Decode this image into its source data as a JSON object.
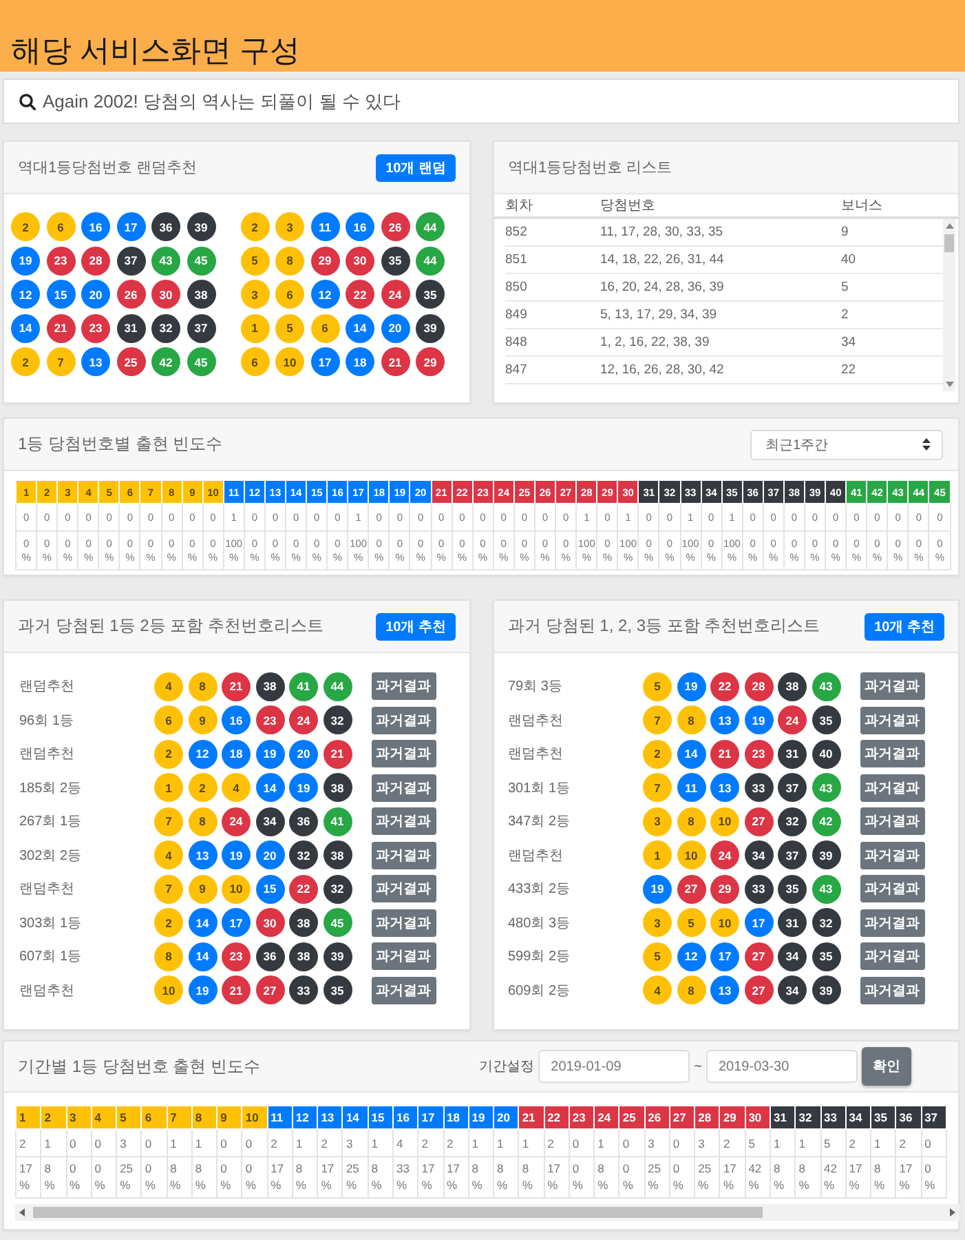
{
  "header": {
    "title": "해당 서비스화면 구성"
  },
  "search": {
    "value": "Again 2002! 당첨의 역사는 되풀이 될 수 있다"
  },
  "random_pick": {
    "title": "역대1등당첨번호 랜덤추천",
    "button": "10개 랜덤",
    "groups": [
      [
        [
          {
            "n": "2",
            "color": "#ffc107"
          },
          {
            "n": "6",
            "color": "#ffc107"
          },
          {
            "n": "16",
            "color": "#007bff"
          },
          {
            "n": "17",
            "color": "#007bff"
          },
          {
            "n": "36",
            "color": "#343a40"
          },
          {
            "n": "39",
            "color": "#343a40"
          }
        ],
        [
          {
            "n": "19",
            "color": "#007bff"
          },
          {
            "n": "23",
            "color": "#dc3545"
          },
          {
            "n": "28",
            "color": "#dc3545"
          },
          {
            "n": "37",
            "color": "#343a40"
          },
          {
            "n": "43",
            "color": "#28a745"
          },
          {
            "n": "45",
            "color": "#28a745"
          }
        ],
        [
          {
            "n": "12",
            "color": "#007bff"
          },
          {
            "n": "15",
            "color": "#007bff"
          },
          {
            "n": "20",
            "color": "#007bff"
          },
          {
            "n": "26",
            "color": "#dc3545"
          },
          {
            "n": "30",
            "color": "#dc3545"
          },
          {
            "n": "38",
            "color": "#343a40"
          }
        ],
        [
          {
            "n": "14",
            "color": "#007bff"
          },
          {
            "n": "21",
            "color": "#dc3545"
          },
          {
            "n": "23",
            "color": "#dc3545"
          },
          {
            "n": "31",
            "color": "#343a40"
          },
          {
            "n": "32",
            "color": "#343a40"
          },
          {
            "n": "37",
            "color": "#343a40"
          }
        ],
        [
          {
            "n": "2",
            "color": "#ffc107"
          },
          {
            "n": "7",
            "color": "#ffc107"
          },
          {
            "n": "13",
            "color": "#007bff"
          },
          {
            "n": "25",
            "color": "#dc3545"
          },
          {
            "n": "42",
            "color": "#28a745"
          },
          {
            "n": "45",
            "color": "#28a745"
          }
        ]
      ],
      [
        [
          {
            "n": "2",
            "color": "#ffc107"
          },
          {
            "n": "3",
            "color": "#ffc107"
          },
          {
            "n": "11",
            "color": "#007bff"
          },
          {
            "n": "16",
            "color": "#007bff"
          },
          {
            "n": "26",
            "color": "#dc3545"
          },
          {
            "n": "44",
            "color": "#28a745"
          }
        ],
        [
          {
            "n": "5",
            "color": "#ffc107"
          },
          {
            "n": "8",
            "color": "#ffc107"
          },
          {
            "n": "29",
            "color": "#dc3545"
          },
          {
            "n": "30",
            "color": "#dc3545"
          },
          {
            "n": "35",
            "color": "#343a40"
          },
          {
            "n": "44",
            "color": "#28a745"
          }
        ],
        [
          {
            "n": "3",
            "color": "#ffc107"
          },
          {
            "n": "6",
            "color": "#ffc107"
          },
          {
            "n": "12",
            "color": "#007bff"
          },
          {
            "n": "22",
            "color": "#dc3545"
          },
          {
            "n": "24",
            "color": "#dc3545"
          },
          {
            "n": "35",
            "color": "#343a40"
          }
        ],
        [
          {
            "n": "1",
            "color": "#ffc107"
          },
          {
            "n": "5",
            "color": "#ffc107"
          },
          {
            "n": "6",
            "color": "#ffc107"
          },
          {
            "n": "14",
            "color": "#007bff"
          },
          {
            "n": "20",
            "color": "#007bff"
          },
          {
            "n": "39",
            "color": "#343a40"
          }
        ],
        [
          {
            "n": "6",
            "color": "#ffc107"
          },
          {
            "n": "10",
            "color": "#ffc107"
          },
          {
            "n": "17",
            "color": "#007bff"
          },
          {
            "n": "18",
            "color": "#007bff"
          },
          {
            "n": "21",
            "color": "#dc3545"
          },
          {
            "n": "29",
            "color": "#dc3545"
          }
        ]
      ]
    ]
  },
  "winning_list": {
    "title": "역대1등당첨번호 리스트",
    "columns": [
      "회차",
      "당첨번호",
      "보너스"
    ],
    "rows": [
      {
        "round": "852",
        "numbers": "11, 17, 28, 30, 33, 35",
        "bonus": "9"
      },
      {
        "round": "851",
        "numbers": "14, 18, 22, 26, 31, 44",
        "bonus": "40"
      },
      {
        "round": "850",
        "numbers": "16, 20, 24, 28, 36, 39",
        "bonus": "5"
      },
      {
        "round": "849",
        "numbers": "5, 13, 17, 29, 34, 39",
        "bonus": "2"
      },
      {
        "round": "848",
        "numbers": "1, 2, 16, 22, 38, 39",
        "bonus": "34"
      },
      {
        "round": "847",
        "numbers": "12, 16, 26, 28, 30, 42",
        "bonus": "22"
      }
    ]
  },
  "weekly_frequency": {
    "title": "1등 당첨번호별 출현 빈도수",
    "select": {
      "value": "최근1주간"
    },
    "columns": [
      {
        "n": "1",
        "color": "#ffc107",
        "count": "0",
        "pct": "0 %"
      },
      {
        "n": "2",
        "color": "#ffc107",
        "count": "0",
        "pct": "0 %"
      },
      {
        "n": "3",
        "color": "#ffc107",
        "count": "0",
        "pct": "0 %"
      },
      {
        "n": "4",
        "color": "#ffc107",
        "count": "0",
        "pct": "0 %"
      },
      {
        "n": "5",
        "color": "#ffc107",
        "count": "0",
        "pct": "0 %"
      },
      {
        "n": "6",
        "color": "#ffc107",
        "count": "0",
        "pct": "0 %"
      },
      {
        "n": "7",
        "color": "#ffc107",
        "count": "0",
        "pct": "0 %"
      },
      {
        "n": "8",
        "color": "#ffc107",
        "count": "0",
        "pct": "0 %"
      },
      {
        "n": "9",
        "color": "#ffc107",
        "count": "0",
        "pct": "0 %"
      },
      {
        "n": "10",
        "color": "#ffc107",
        "count": "0",
        "pct": "0 %"
      },
      {
        "n": "11",
        "color": "#007bff",
        "count": "1",
        "pct": "100 %"
      },
      {
        "n": "12",
        "color": "#007bff",
        "count": "0",
        "pct": "0 %"
      },
      {
        "n": "13",
        "color": "#007bff",
        "count": "0",
        "pct": "0 %"
      },
      {
        "n": "14",
        "color": "#007bff",
        "count": "0",
        "pct": "0 %"
      },
      {
        "n": "15",
        "color": "#007bff",
        "count": "0",
        "pct": "0 %"
      },
      {
        "n": "16",
        "color": "#007bff",
        "count": "0",
        "pct": "0 %"
      },
      {
        "n": "17",
        "color": "#007bff",
        "count": "1",
        "pct": "100 %"
      },
      {
        "n": "18",
        "color": "#007bff",
        "count": "0",
        "pct": "0 %"
      },
      {
        "n": "19",
        "color": "#007bff",
        "count": "0",
        "pct": "0 %"
      },
      {
        "n": "20",
        "color": "#007bff",
        "count": "0",
        "pct": "0 %"
      },
      {
        "n": "21",
        "color": "#dc3545",
        "count": "0",
        "pct": "0 %"
      },
      {
        "n": "22",
        "color": "#dc3545",
        "count": "0",
        "pct": "0 %"
      },
      {
        "n": "23",
        "color": "#dc3545",
        "count": "0",
        "pct": "0 %"
      },
      {
        "n": "24",
        "color": "#dc3545",
        "count": "0",
        "pct": "0 %"
      },
      {
        "n": "25",
        "color": "#dc3545",
        "count": "0",
        "pct": "0 %"
      },
      {
        "n": "26",
        "color": "#dc3545",
        "count": "0",
        "pct": "0 %"
      },
      {
        "n": "27",
        "color": "#dc3545",
        "count": "0",
        "pct": "0 %"
      },
      {
        "n": "28",
        "color": "#dc3545",
        "count": "1",
        "pct": "100 %"
      },
      {
        "n": "29",
        "color": "#dc3545",
        "count": "0",
        "pct": "0 %"
      },
      {
        "n": "30",
        "color": "#dc3545",
        "count": "1",
        "pct": "100 %"
      },
      {
        "n": "31",
        "color": "#343a40",
        "count": "0",
        "pct": "0 %"
      },
      {
        "n": "32",
        "color": "#343a40",
        "count": "0",
        "pct": "0 %"
      },
      {
        "n": "33",
        "color": "#343a40",
        "count": "1",
        "pct": "100 %"
      },
      {
        "n": "34",
        "color": "#343a40",
        "count": "0",
        "pct": "0 %"
      },
      {
        "n": "35",
        "color": "#343a40",
        "count": "1",
        "pct": "100 %"
      },
      {
        "n": "36",
        "color": "#343a40",
        "count": "0",
        "pct": "0 %"
      },
      {
        "n": "37",
        "color": "#343a40",
        "count": "0",
        "pct": "0 %"
      },
      {
        "n": "38",
        "color": "#343a40",
        "count": "0",
        "pct": "0 %"
      },
      {
        "n": "39",
        "color": "#343a40",
        "count": "0",
        "pct": "0 %"
      },
      {
        "n": "40",
        "color": "#343a40",
        "count": "0",
        "pct": "0 %"
      },
      {
        "n": "41",
        "color": "#28a745",
        "count": "0",
        "pct": "0 %"
      },
      {
        "n": "42",
        "color": "#28a745",
        "count": "0",
        "pct": "0 %"
      },
      {
        "n": "43",
        "color": "#28a745",
        "count": "0",
        "pct": "0 %"
      },
      {
        "n": "44",
        "color": "#28a745",
        "count": "0",
        "pct": "0 %"
      },
      {
        "n": "45",
        "color": "#28a745",
        "count": "0",
        "pct": "0 %"
      }
    ]
  },
  "past_top2_list": {
    "title": "과거 당첨된 1등 2등 포함 추천번호리스트",
    "button": "10개 추천",
    "rows": [
      {
        "label": "랜덤추천",
        "button": "과거결과",
        "balls": [
          {
            "n": "4",
            "color": "#ffc107"
          },
          {
            "n": "8",
            "color": "#ffc107"
          },
          {
            "n": "21",
            "color": "#dc3545"
          },
          {
            "n": "38",
            "color": "#343a40"
          },
          {
            "n": "41",
            "color": "#28a745"
          },
          {
            "n": "44",
            "color": "#28a745"
          }
        ]
      },
      {
        "label": "96회 1등",
        "button": "과거결과",
        "balls": [
          {
            "n": "6",
            "color": "#ffc107"
          },
          {
            "n": "9",
            "color": "#ffc107"
          },
          {
            "n": "16",
            "color": "#007bff"
          },
          {
            "n": "23",
            "color": "#dc3545"
          },
          {
            "n": "24",
            "color": "#dc3545"
          },
          {
            "n": "32",
            "color": "#343a40"
          }
        ]
      },
      {
        "label": "랜덤추천",
        "button": "과거결과",
        "balls": [
          {
            "n": "2",
            "color": "#ffc107"
          },
          {
            "n": "12",
            "color": "#007bff"
          },
          {
            "n": "18",
            "color": "#007bff"
          },
          {
            "n": "19",
            "color": "#007bff"
          },
          {
            "n": "20",
            "color": "#007bff"
          },
          {
            "n": "21",
            "color": "#dc3545"
          }
        ]
      },
      {
        "label": "185회 2등",
        "button": "과거결과",
        "balls": [
          {
            "n": "1",
            "color": "#ffc107"
          },
          {
            "n": "2",
            "color": "#ffc107"
          },
          {
            "n": "4",
            "color": "#ffc107"
          },
          {
            "n": "14",
            "color": "#007bff"
          },
          {
            "n": "19",
            "color": "#007bff"
          },
          {
            "n": "38",
            "color": "#343a40"
          }
        ]
      },
      {
        "label": "267회 1등",
        "button": "과거결과",
        "balls": [
          {
            "n": "7",
            "color": "#ffc107"
          },
          {
            "n": "8",
            "color": "#ffc107"
          },
          {
            "n": "24",
            "color": "#dc3545"
          },
          {
            "n": "34",
            "color": "#343a40"
          },
          {
            "n": "36",
            "color": "#343a40"
          },
          {
            "n": "41",
            "color": "#28a745"
          }
        ]
      },
      {
        "label": "302회 2등",
        "button": "과거결과",
        "balls": [
          {
            "n": "4",
            "color": "#ffc107"
          },
          {
            "n": "13",
            "color": "#007bff"
          },
          {
            "n": "19",
            "color": "#007bff"
          },
          {
            "n": "20",
            "color": "#007bff"
          },
          {
            "n": "32",
            "color": "#343a40"
          },
          {
            "n": "38",
            "color": "#343a40"
          }
        ]
      },
      {
        "label": "랜덤추천",
        "button": "과거결과",
        "balls": [
          {
            "n": "7",
            "color": "#ffc107"
          },
          {
            "n": "9",
            "color": "#ffc107"
          },
          {
            "n": "10",
            "color": "#ffc107"
          },
          {
            "n": "15",
            "color": "#007bff"
          },
          {
            "n": "22",
            "color": "#dc3545"
          },
          {
            "n": "32",
            "color": "#343a40"
          }
        ]
      },
      {
        "label": "303회 1등",
        "button": "과거결과",
        "balls": [
          {
            "n": "2",
            "color": "#ffc107"
          },
          {
            "n": "14",
            "color": "#007bff"
          },
          {
            "n": "17",
            "color": "#007bff"
          },
          {
            "n": "30",
            "color": "#dc3545"
          },
          {
            "n": "38",
            "color": "#343a40"
          },
          {
            "n": "45",
            "color": "#28a745"
          }
        ]
      },
      {
        "label": "607회 1등",
        "button": "과거결과",
        "balls": [
          {
            "n": "8",
            "color": "#ffc107"
          },
          {
            "n": "14",
            "color": "#007bff"
          },
          {
            "n": "23",
            "color": "#dc3545"
          },
          {
            "n": "36",
            "color": "#343a40"
          },
          {
            "n": "38",
            "color": "#343a40"
          },
          {
            "n": "39",
            "color": "#343a40"
          }
        ]
      },
      {
        "label": "랜덤추천",
        "button": "과거결과",
        "balls": [
          {
            "n": "10",
            "color": "#ffc107"
          },
          {
            "n": "19",
            "color": "#007bff"
          },
          {
            "n": "21",
            "color": "#dc3545"
          },
          {
            "n": "27",
            "color": "#dc3545"
          },
          {
            "n": "33",
            "color": "#343a40"
          },
          {
            "n": "35",
            "color": "#343a40"
          }
        ]
      }
    ]
  },
  "past_top3_list": {
    "title": "과거 당첨된 1, 2, 3등 포함 추천번호리스트",
    "button": "10개 추천",
    "rows": [
      {
        "label": "79회 3등",
        "button": "과거결과",
        "balls": [
          {
            "n": "5",
            "color": "#ffc107"
          },
          {
            "n": "19",
            "color": "#007bff"
          },
          {
            "n": "22",
            "color": "#dc3545"
          },
          {
            "n": "28",
            "color": "#dc3545"
          },
          {
            "n": "38",
            "color": "#343a40"
          },
          {
            "n": "43",
            "color": "#28a745"
          }
        ]
      },
      {
        "label": "랜덤추천",
        "button": "과거결과",
        "balls": [
          {
            "n": "7",
            "color": "#ffc107"
          },
          {
            "n": "8",
            "color": "#ffc107"
          },
          {
            "n": "13",
            "color": "#007bff"
          },
          {
            "n": "19",
            "color": "#007bff"
          },
          {
            "n": "24",
            "color": "#dc3545"
          },
          {
            "n": "35",
            "color": "#343a40"
          }
        ]
      },
      {
        "label": "랜덤추천",
        "button": "과거결과",
        "balls": [
          {
            "n": "2",
            "color": "#ffc107"
          },
          {
            "n": "14",
            "color": "#007bff"
          },
          {
            "n": "21",
            "color": "#dc3545"
          },
          {
            "n": "23",
            "color": "#dc3545"
          },
          {
            "n": "31",
            "color": "#343a40"
          },
          {
            "n": "40",
            "color": "#343a40"
          }
        ]
      },
      {
        "label": "301회 1등",
        "button": "과거결과",
        "balls": [
          {
            "n": "7",
            "color": "#ffc107"
          },
          {
            "n": "11",
            "color": "#007bff"
          },
          {
            "n": "13",
            "color": "#007bff"
          },
          {
            "n": "33",
            "color": "#343a40"
          },
          {
            "n": "37",
            "color": "#343a40"
          },
          {
            "n": "43",
            "color": "#28a745"
          }
        ]
      },
      {
        "label": "347회 2등",
        "button": "과거결과",
        "balls": [
          {
            "n": "3",
            "color": "#ffc107"
          },
          {
            "n": "8",
            "color": "#ffc107"
          },
          {
            "n": "10",
            "color": "#ffc107"
          },
          {
            "n": "27",
            "color": "#dc3545"
          },
          {
            "n": "32",
            "color": "#343a40"
          },
          {
            "n": "42",
            "color": "#28a745"
          }
        ]
      },
      {
        "label": "랜덤추천",
        "button": "과거결과",
        "balls": [
          {
            "n": "1",
            "color": "#ffc107"
          },
          {
            "n": "10",
            "color": "#ffc107"
          },
          {
            "n": "24",
            "color": "#dc3545"
          },
          {
            "n": "34",
            "color": "#343a40"
          },
          {
            "n": "37",
            "color": "#343a40"
          },
          {
            "n": "39",
            "color": "#343a40"
          }
        ]
      },
      {
        "label": "433회 2등",
        "button": "과거결과",
        "balls": [
          {
            "n": "19",
            "color": "#007bff"
          },
          {
            "n": "27",
            "color": "#dc3545"
          },
          {
            "n": "29",
            "color": "#dc3545"
          },
          {
            "n": "33",
            "color": "#343a40"
          },
          {
            "n": "35",
            "color": "#343a40"
          },
          {
            "n": "43",
            "color": "#28a745"
          }
        ]
      },
      {
        "label": "480회 3등",
        "button": "과거결과",
        "balls": [
          {
            "n": "3",
            "color": "#ffc107"
          },
          {
            "n": "5",
            "color": "#ffc107"
          },
          {
            "n": "10",
            "color": "#ffc107"
          },
          {
            "n": "17",
            "color": "#007bff"
          },
          {
            "n": "31",
            "color": "#343a40"
          },
          {
            "n": "32",
            "color": "#343a40"
          }
        ]
      },
      {
        "label": "599회 2등",
        "button": "과거결과",
        "balls": [
          {
            "n": "5",
            "color": "#ffc107"
          },
          {
            "n": "12",
            "color": "#007bff"
          },
          {
            "n": "17",
            "color": "#007bff"
          },
          {
            "n": "27",
            "color": "#dc3545"
          },
          {
            "n": "34",
            "color": "#343a40"
          },
          {
            "n": "35",
            "color": "#343a40"
          }
        ]
      },
      {
        "label": "609회 2등",
        "button": "과거결과",
        "balls": [
          {
            "n": "4",
            "color": "#ffc107"
          },
          {
            "n": "8",
            "color": "#ffc107"
          },
          {
            "n": "13",
            "color": "#007bff"
          },
          {
            "n": "27",
            "color": "#dc3545"
          },
          {
            "n": "34",
            "color": "#343a40"
          },
          {
            "n": "39",
            "color": "#343a40"
          }
        ]
      }
    ]
  },
  "period_frequency": {
    "title": "기간별 1등 당첨번호 출현 빈도수",
    "label": "기간설정",
    "from": "2019-01-09",
    "separator": "~",
    "to": "2019-03-30",
    "button": "확인",
    "columns": [
      {
        "n": "1",
        "color": "#ffc107",
        "count": "2",
        "pct": "17 %"
      },
      {
        "n": "2",
        "color": "#ffc107",
        "count": "1",
        "pct": "8 %"
      },
      {
        "n": "3",
        "color": "#ffc107",
        "count": "0",
        "pct": "0 %"
      },
      {
        "n": "4",
        "color": "#ffc107",
        "count": "0",
        "pct": "0 %"
      },
      {
        "n": "5",
        "color": "#ffc107",
        "count": "3",
        "pct": "25 %"
      },
      {
        "n": "6",
        "color": "#ffc107",
        "count": "0",
        "pct": "0 %"
      },
      {
        "n": "7",
        "color": "#ffc107",
        "count": "1",
        "pct": "8 %"
      },
      {
        "n": "8",
        "color": "#ffc107",
        "count": "1",
        "pct": "8 %"
      },
      {
        "n": "9",
        "color": "#ffc107",
        "count": "0",
        "pct": "0 %"
      },
      {
        "n": "10",
        "color": "#ffc107",
        "count": "0",
        "pct": "0 %"
      },
      {
        "n": "11",
        "color": "#007bff",
        "count": "2",
        "pct": "17 %"
      },
      {
        "n": "12",
        "color": "#007bff",
        "count": "1",
        "pct": "8 %"
      },
      {
        "n": "13",
        "color": "#007bff",
        "count": "2",
        "pct": "17 %"
      },
      {
        "n": "14",
        "color": "#007bff",
        "count": "3",
        "pct": "25 %"
      },
      {
        "n": "15",
        "color": "#007bff",
        "count": "1",
        "pct": "8 %"
      },
      {
        "n": "16",
        "color": "#007bff",
        "count": "4",
        "pct": "33 %"
      },
      {
        "n": "17",
        "color": "#007bff",
        "count": "2",
        "pct": "17 %"
      },
      {
        "n": "18",
        "color": "#007bff",
        "count": "2",
        "pct": "17 %"
      },
      {
        "n": "19",
        "color": "#007bff",
        "count": "1",
        "pct": "8 %"
      },
      {
        "n": "20",
        "color": "#007bff",
        "count": "1",
        "pct": "8 %"
      },
      {
        "n": "21",
        "color": "#dc3545",
        "count": "1",
        "pct": "8 %"
      },
      {
        "n": "22",
        "color": "#dc3545",
        "count": "2",
        "pct": "17 %"
      },
      {
        "n": "23",
        "color": "#dc3545",
        "count": "0",
        "pct": "0 %"
      },
      {
        "n": "24",
        "color": "#dc3545",
        "count": "1",
        "pct": "8 %"
      },
      {
        "n": "25",
        "color": "#dc3545",
        "count": "0",
        "pct": "0 %"
      },
      {
        "n": "26",
        "color": "#dc3545",
        "count": "3",
        "pct": "25 %"
      },
      {
        "n": "27",
        "color": "#dc3545",
        "count": "0",
        "pct": "0 %"
      },
      {
        "n": "28",
        "color": "#dc3545",
        "count": "3",
        "pct": "25 %"
      },
      {
        "n": "29",
        "color": "#dc3545",
        "count": "2",
        "pct": "17 %"
      },
      {
        "n": "30",
        "color": "#dc3545",
        "count": "5",
        "pct": "42 %"
      },
      {
        "n": "31",
        "color": "#343a40",
        "count": "1",
        "pct": "8 %"
      },
      {
        "n": "32",
        "color": "#343a40",
        "count": "1",
        "pct": "8 %"
      },
      {
        "n": "33",
        "color": "#343a40",
        "count": "5",
        "pct": "42 %"
      },
      {
        "n": "34",
        "color": "#343a40",
        "count": "2",
        "pct": "17 %"
      },
      {
        "n": "35",
        "color": "#343a40",
        "count": "1",
        "pct": "8 %"
      },
      {
        "n": "36",
        "color": "#343a40",
        "count": "2",
        "pct": "17 %"
      },
      {
        "n": "37",
        "color": "#343a40",
        "count": "0",
        "pct": "0 %"
      }
    ]
  }
}
